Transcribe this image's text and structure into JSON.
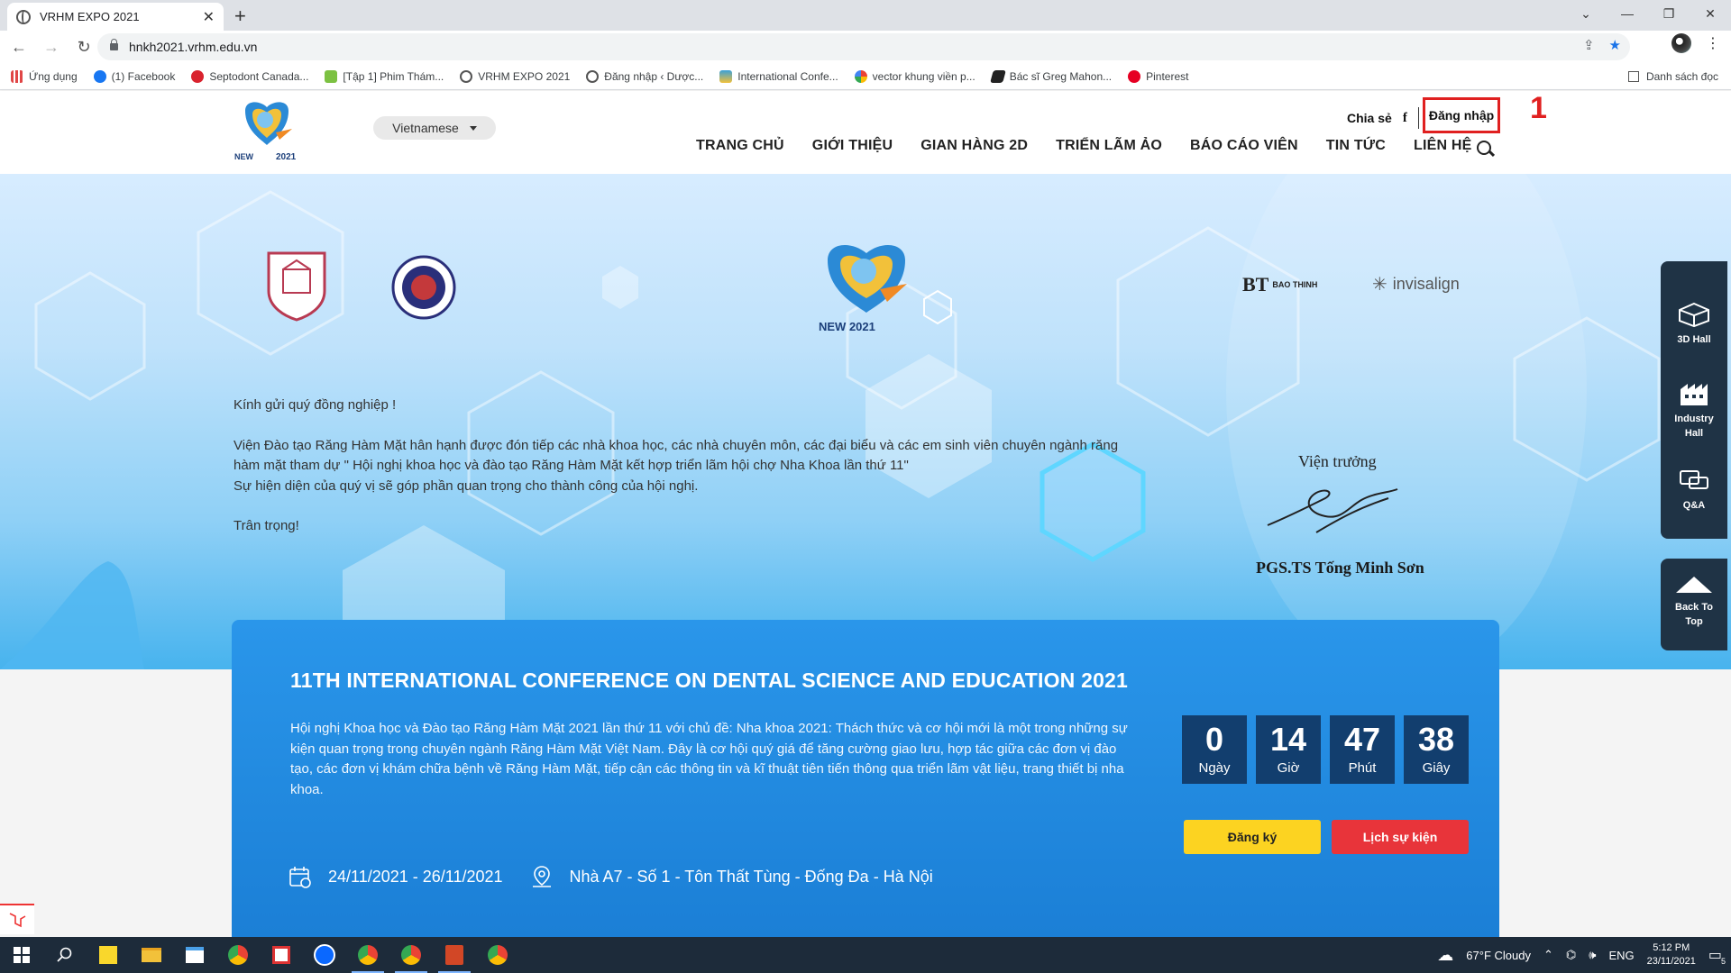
{
  "browser": {
    "tab_title": "VRHM EXPO 2021",
    "tab_close": "✕",
    "new_tab": "+",
    "url": "hnkh2021.vrhm.edu.vn",
    "window_controls": [
      "⌄",
      "—",
      "❐",
      "✕"
    ],
    "bookmarks": [
      {
        "label": "Ứng dụng",
        "color": "#e04646"
      },
      {
        "label": "(1) Facebook",
        "color": "#1877f2"
      },
      {
        "label": "Septodont Canada...",
        "color": "#d9232e"
      },
      {
        "label": "[Tập 1] Phim Thám...",
        "color": "#7cc142"
      },
      {
        "label": "VRHM EXPO 2021",
        "color": "#555555"
      },
      {
        "label": "Đăng nhập ‹ Dược...",
        "color": "#555555"
      },
      {
        "label": "International Confe...",
        "color": "#3aa0d8"
      },
      {
        "label": "vector khung viền p...",
        "color": "#4285f4"
      },
      {
        "label": "Bác sĩ Greg Mahon...",
        "color": "#222222"
      },
      {
        "label": "Pinterest",
        "color": "#e60023"
      }
    ],
    "reading_list": "Danh sách đọc"
  },
  "header": {
    "language": "Vietnamese",
    "share_label": "Chia sẻ",
    "fb_glyph": "f",
    "login_label": "Đăng nhập",
    "step_marker": "1",
    "nav": [
      "TRANG CHỦ",
      "GIỚI THIỆU",
      "GIAN HÀNG 2D",
      "TRIỂN LÃM ẢO",
      "BÁO CÁO VIÊN",
      "TIN TỨC",
      "LIÊN HỆ"
    ]
  },
  "hero": {
    "logo_text": "NEW 2021",
    "partners": [
      "BAO THINH",
      "invisalign"
    ],
    "greeting": "Kính gửi quý đồng nghiệp !",
    "body_line1": "Viện Đào tạo Răng Hàm Mặt hân hạnh được đón tiếp các nhà khoa học, các nhà chuyên môn, các đại biểu và các em sinh viên chuyên ngành răng hàm mặt tham dự \" Hội nghị khoa học và đào tạo Răng Hàm Mặt kết hợp triển lãm hội chợ Nha Khoa lần thứ 11\"",
    "body_line2": "Sự hiện diện của quý vị sẽ góp phần quan trọng cho thành công của hội nghị.",
    "closing": "Trân trọng!",
    "signature_title": "Viện trưởng",
    "signature_name": "PGS.TS Tống Minh Sơn"
  },
  "side_panel": {
    "items": [
      "3D Hall",
      "Industry Hall",
      "Q&A"
    ],
    "back_to_top": "Back To Top"
  },
  "conference": {
    "title": "11TH INTERNATIONAL CONFERENCE ON DENTAL SCIENCE AND EDUCATION 2021",
    "description": "Hội nghị Khoa học và Đào tạo Răng Hàm Mặt 2021 lần thứ 11 với chủ đề: Nha khoa 2021: Thách thức và cơ hội mới là một trong những sự kiện quan trọng trong chuyên ngành Răng Hàm Mặt Việt Nam. Đây là cơ hội quý giá để tăng cường giao lưu, hợp tác giữa các đơn vị đào tạo, các đơn vị khám chữa bệnh về Răng Hàm Mặt, tiếp cận các thông tin và kĩ thuật tiên tiến thông qua triển lãm vật liệu, trang thiết bị nha khoa.",
    "countdown": [
      {
        "value": "0",
        "label": "Ngày"
      },
      {
        "value": "14",
        "label": "Giờ"
      },
      {
        "value": "47",
        "label": "Phút"
      },
      {
        "value": "38",
        "label": "Giây"
      }
    ],
    "register_label": "Đăng ký",
    "schedule_label": "Lịch sự kiện",
    "date_range": "24/11/2021 - 26/11/2021",
    "location": "Nhà A7 - Số 1 - Tôn Thất Tùng - Đống Đa - Hà Nội"
  },
  "taskbar": {
    "weather": "67°F  Cloudy",
    "lang": "ENG",
    "time": "5:12 PM",
    "date": "23/11/2021",
    "notif_count": "5"
  },
  "colors": {
    "accent_blue": "#1b7fd6",
    "countdown_bg": "#123e6e",
    "register": "#fcd321",
    "schedule": "#e8343a",
    "highlight_red": "#e02020"
  }
}
